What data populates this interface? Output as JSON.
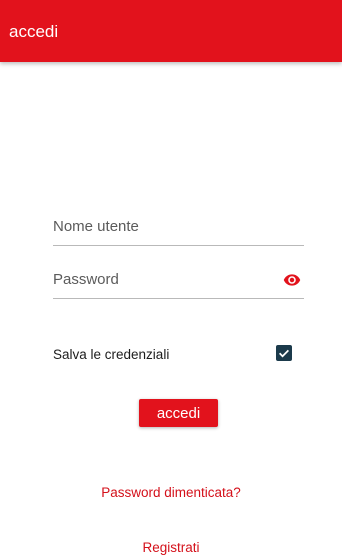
{
  "appbar": {
    "title": "accedi"
  },
  "form": {
    "username": {
      "placeholder": "Nome utente",
      "value": ""
    },
    "password": {
      "placeholder": "Password",
      "value": "",
      "toggle_icon": "eye-icon"
    },
    "remember": {
      "label": "Salva le credenziali",
      "checked": true
    },
    "submit_label": "accedi"
  },
  "links": {
    "forgot_password": "Password dimenticata?",
    "register": "Registrati"
  },
  "colors": {
    "accent": "#e2121c",
    "checkbox": "#1b3a4b"
  }
}
